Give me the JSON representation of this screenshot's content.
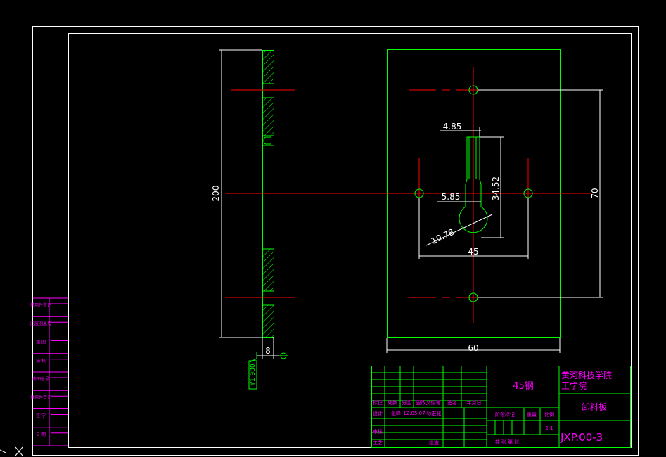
{
  "colors": {
    "background": "#000000",
    "frame": "#ffffff",
    "geometry": "#00ff00",
    "centerline": "#ff0000",
    "dimension": "#ffffff",
    "sidebar": "#ff00ff",
    "title_block": "#00ff00"
  },
  "side_view": {
    "dim_length": "200",
    "dim_thickness": "8",
    "roughness": "Y1 980"
  },
  "front_view": {
    "dim_width": "60",
    "dim_hole_spacing_h": "45",
    "dim_hole_spacing_v": "70",
    "dim_slot_width": "4.85",
    "dim_slot_length": "34.52",
    "dim_offset": "5.85",
    "dim_round_diameter": "10.78"
  },
  "title_block": {
    "material": "45钢",
    "school": "黄河科技学院",
    "school_sub": "工学院",
    "part_name": "卸料板",
    "drawing_no": "JXP.00-3",
    "scale": "2:1",
    "labels": {
      "mark": "标记",
      "count": "处数",
      "zone": "分区",
      "change_doc": "更改文件号",
      "sign": "签名",
      "date": "年月日",
      "design": "设计",
      "designer": "张峰",
      "design_date": "12.05.07",
      "standardize": "标准化",
      "check": "审核",
      "process": "工艺",
      "approve": "批准",
      "stage_mark": "阶段标记",
      "weight": "重量",
      "ratio": "比例",
      "sheets": "共  张  第  张"
    }
  },
  "sidebar": {
    "rows": [
      "借用件登记",
      "旧底图总号",
      "描  图",
      "描  校",
      "底图总号",
      "借用件登记",
      "签  字",
      "日  期"
    ]
  }
}
